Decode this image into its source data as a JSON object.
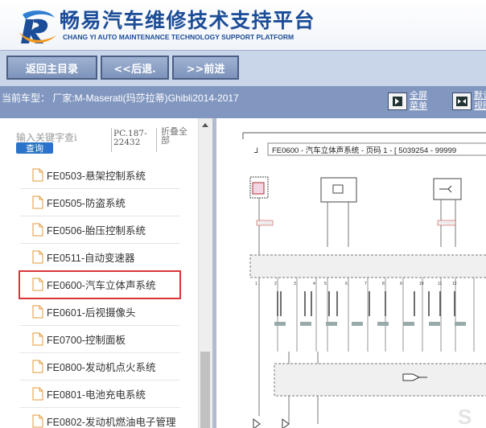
{
  "header": {
    "title_cn": "畅易汽车维修技术支持平台",
    "title_en": "CHANG YI AUTO MAINTENANCE TECHNOLOGY SUPPORT PLATFORM"
  },
  "toolbar": {
    "home_label": "返回主目录",
    "back_label": "<<后退.",
    "forward_label": ">>前进"
  },
  "infobar": {
    "vehicle_text": "当前车型： 厂家:M-Maserati(玛莎拉蒂)Ghibli2014-2017",
    "fullscreen_line1": "全屏",
    "fullscreen_line2": "菜单",
    "default_line1": "默认",
    "default_line2": "视图"
  },
  "search": {
    "placeholder": "输入关键字查i",
    "button_label": "查询",
    "pc_text": "PC.187-22432",
    "collapse_label": "折叠全部"
  },
  "tree": [
    {
      "label": "FE0503-悬架控制系统",
      "selected": false
    },
    {
      "label": "FE0505-防盗系统",
      "selected": false
    },
    {
      "label": "FE0506-胎压控制系统",
      "selected": false
    },
    {
      "label": "FE0511-自动变速器",
      "selected": false
    },
    {
      "label": "FE0600-汽车立体声系统",
      "selected": true
    },
    {
      "label": "FE0601-后视摄像头",
      "selected": false
    },
    {
      "label": "FE0700-控制面板",
      "selected": false
    },
    {
      "label": "FE0800-发动机点火系统",
      "selected": false
    },
    {
      "label": "FE0801-电池充电系统",
      "selected": false
    },
    {
      "label": "FE0802-发动机燃油电子管理",
      "selected": false
    }
  ],
  "diagram": {
    "title": "FE0600 - 汽车立体声系统 - 页码 1 - [ 5039254 - 99999"
  },
  "colors": {
    "brand_blue": "#1b4c97",
    "toolbar_bg": "#c9d5e8",
    "infobar_bg": "#8297c0",
    "selected_outline": "#d9353a"
  }
}
